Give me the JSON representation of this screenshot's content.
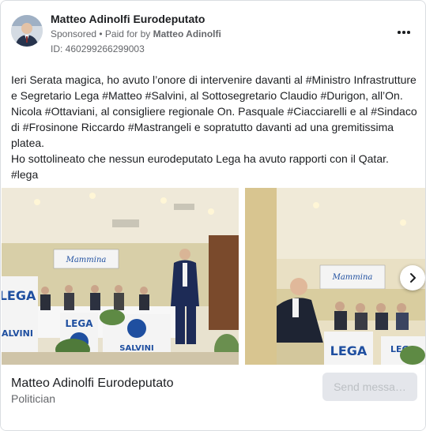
{
  "post": {
    "page_name": "Matteo Adinolfi Eurodeputato",
    "sponsored": "Sponsored",
    "separator": " • ",
    "paid_for_by": "Paid for by ",
    "funder": "Matteo Adinolfi",
    "library_id": "ID: 460299266299003",
    "more_icon": "more-horizontal-icon",
    "text_lines": [
      "Ieri Serata magica, ho avuto l’onore di intervenire davanti al #Ministro Infrastrutture",
      "e Segretario Lega #Matteo #Salvini, al Sottosegretario Claudio #Durigon, all’On.",
      "Nicola #Ottaviani, al consigliere regionale On. Pasquale #Ciacciarelli e al #Sindaco",
      "di #Frosinone Riccardo #Mastrangeli e sopratutto davanti ad una gremitissima",
      "platea.",
      "Ho sottolineato che nessun eurodeputato Lega ha avuto rapporti con il Qatar.",
      "#lega"
    ]
  },
  "carousel": {
    "banner_text": "Mammina",
    "sign_text": "LEGA",
    "sign_sub": "SALVINI",
    "next_icon": "chevron-right-icon"
  },
  "footer": {
    "title": "Matteo Adinolfi Eurodeputato",
    "subtitle": "Politician",
    "button_label": "Send messa…"
  },
  "colors": {
    "text": "#1c1e21",
    "secondary": "#65676b",
    "button_bg": "#e4e6eb",
    "button_text": "#bcc0c4",
    "lega_blue": "#1f4fa0"
  }
}
